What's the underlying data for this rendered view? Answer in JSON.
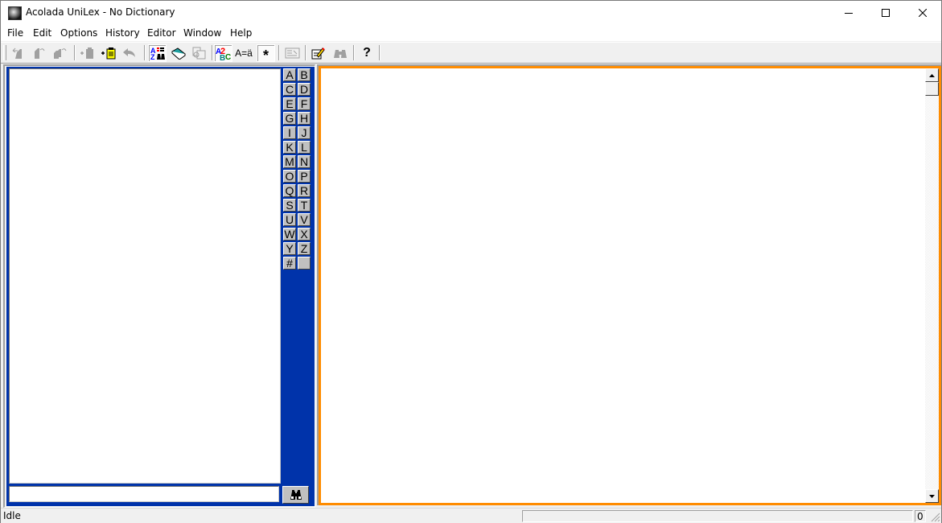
{
  "window": {
    "title": "Acolada UniLex - No Dictionary",
    "controls": {
      "minimize": "minimize-icon",
      "maximize": "maximize-icon",
      "close": "close-icon"
    }
  },
  "menu": {
    "items": [
      {
        "label": "File"
      },
      {
        "label": "Edit"
      },
      {
        "label": "Options"
      },
      {
        "label": "History"
      },
      {
        "label": "Editor"
      },
      {
        "label": "Window"
      },
      {
        "label": "Help"
      }
    ]
  },
  "toolbar": {
    "buttons": [
      {
        "icon": "back-icon",
        "enabled": false
      },
      {
        "icon": "forward-icon",
        "enabled": false
      },
      {
        "icon": "history-icon",
        "enabled": false
      },
      {
        "icon": "import-icon",
        "enabled": false
      },
      {
        "icon": "paste-clipboard-icon",
        "enabled": true
      },
      {
        "icon": "undo-icon",
        "enabled": false
      },
      {
        "icon": "sort-az-icon",
        "enabled": true,
        "pressed": true
      },
      {
        "icon": "dictionary-book-icon",
        "enabled": true
      },
      {
        "icon": "copy-document-icon",
        "enabled": false
      },
      {
        "icon": "spellcheck-abc-icon",
        "enabled": true,
        "pressed": true
      },
      {
        "icon": "umlaut-toggle-icon",
        "label": "A=ä",
        "enabled": true
      },
      {
        "icon": "wildcard-star-icon",
        "label": "*",
        "enabled": true,
        "pressed": true
      },
      {
        "icon": "form-view-icon",
        "enabled": false
      },
      {
        "icon": "edit-note-icon",
        "enabled": true
      },
      {
        "icon": "binoculars-find-icon",
        "enabled": false
      },
      {
        "icon": "help-question-icon",
        "label": "?",
        "enabled": true
      }
    ]
  },
  "left_panel": {
    "word_list_items": [],
    "alphabet": [
      "A",
      "B",
      "C",
      "D",
      "E",
      "F",
      "G",
      "H",
      "I",
      "J",
      "K",
      "L",
      "M",
      "N",
      "O",
      "P",
      "Q",
      "R",
      "S",
      "T",
      "U",
      "V",
      "W",
      "X",
      "Y",
      "Z",
      "#",
      ""
    ],
    "search_value": "",
    "search_button_icon": "binoculars-icon"
  },
  "right_panel": {
    "content": ""
  },
  "status": {
    "text": "Idle",
    "progress": "",
    "count": "0"
  },
  "colors": {
    "left_frame": "#0033aa",
    "right_frame": "#ff8c00"
  }
}
